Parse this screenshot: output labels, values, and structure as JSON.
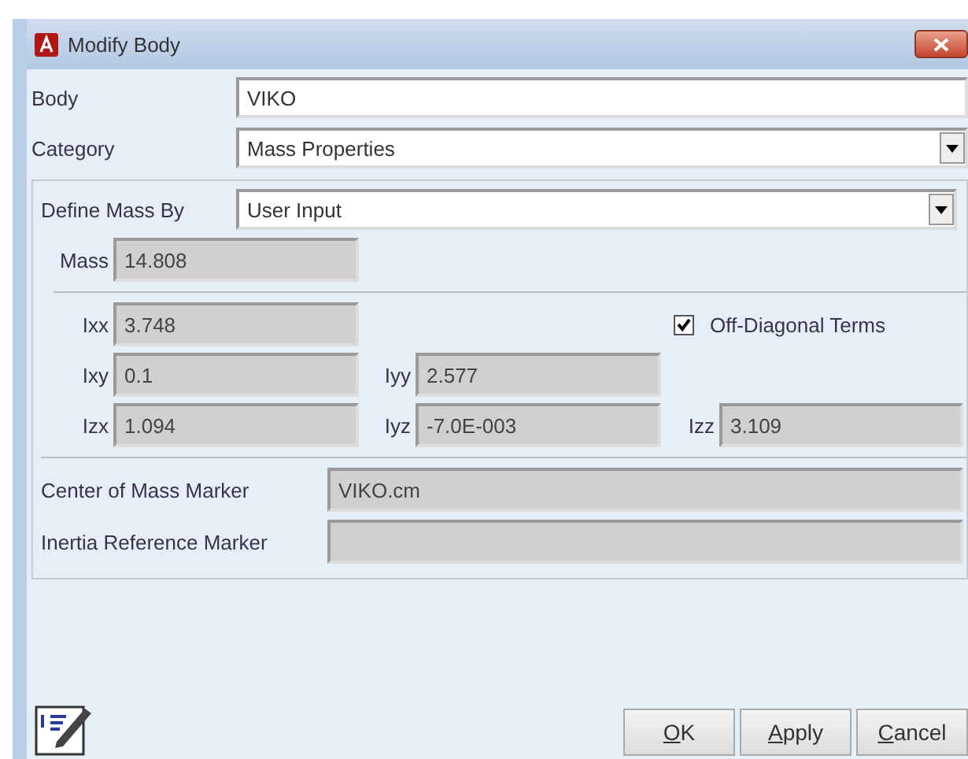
{
  "window": {
    "title": "Modify Body"
  },
  "body": {
    "label": "Body",
    "value": "VIKO"
  },
  "category": {
    "label": "Category",
    "value": "Mass Properties"
  },
  "define_mass_by": {
    "label": "Define Mass By",
    "value": "User Input"
  },
  "mass": {
    "label": "Mass",
    "value": "14.808"
  },
  "inertia": [
    {
      "label": "Ixx",
      "value": "3.748"
    },
    {
      "label": "Ixy",
      "value": "0.1"
    },
    {
      "label": "Iyy",
      "value": "2.577"
    },
    {
      "label": "Izx",
      "value": "1.094"
    },
    {
      "label": "Iyz",
      "value": "-7.0E-003"
    },
    {
      "label": "Izz",
      "value": "3.109"
    }
  ],
  "off_diagonal": {
    "label": "Off-Diagonal Terms",
    "checked": true
  },
  "markers": [
    {
      "label": "Center of Mass Marker",
      "value": "VIKO.cm"
    },
    {
      "label": "Inertia Reference Marker"
    }
  ],
  "buttons": [
    {
      "label": "OK"
    },
    {
      "label": "Apply"
    },
    {
      "label": "Cancel"
    }
  ]
}
